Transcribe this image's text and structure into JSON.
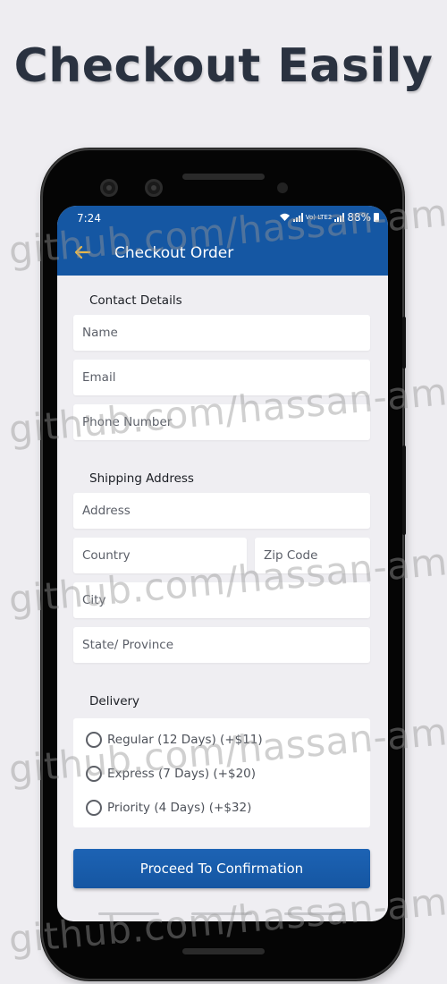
{
  "headline": "Checkout Easily",
  "status_bar": {
    "time": "7:24",
    "network": "Vo) LTE2",
    "battery": "88%"
  },
  "app_bar": {
    "title": "Checkout Order",
    "back_icon": "arrow-left-icon",
    "accent": "#1557a3",
    "back_icon_color": "#e8b84a"
  },
  "contact": {
    "title": "Contact Details",
    "name_placeholder": "Name",
    "email_placeholder": "Email",
    "phone_placeholder": "Phone Number"
  },
  "shipping": {
    "title": "Shipping Address",
    "address_placeholder": "Address",
    "country_placeholder": "Country",
    "zip_placeholder": "Zip Code",
    "city_placeholder": "City",
    "state_placeholder": "State/ Province"
  },
  "delivery": {
    "title": "Delivery",
    "options": [
      {
        "label": "Regular (12 Days) (+$11)",
        "selected": false
      },
      {
        "label": "Express (7 Days) (+$20)",
        "selected": false
      },
      {
        "label": "Priority (4 Days) (+$32)",
        "selected": false
      }
    ]
  },
  "proceed_button": "Proceed To Confirmation",
  "watermark": "github.com/hassan-amr"
}
